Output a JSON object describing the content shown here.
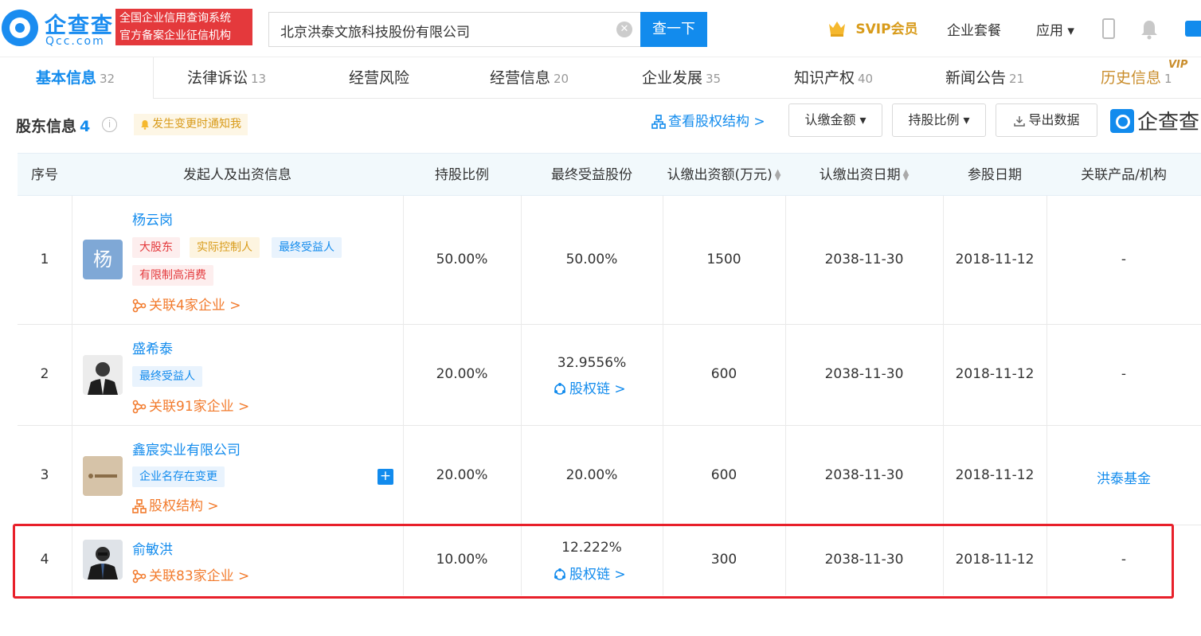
{
  "brand": {
    "logo_cn": "企查查",
    "logo_en": "Qcc.com",
    "slogan_line1": "全国企业信用查询系统",
    "slogan_line2": "官方备案企业征信机构"
  },
  "search": {
    "query": "北京洪泰文旅科技股份有限公司",
    "clear": "✕",
    "button": "查一下"
  },
  "topnav": {
    "svip": "SVIP会员",
    "package": "企业套餐",
    "apps": "应用 ▾"
  },
  "tabs": [
    {
      "label": "基本信息",
      "count": "32"
    },
    {
      "label": "法律诉讼",
      "count": "13"
    },
    {
      "label": "经营风险",
      "count": ""
    },
    {
      "label": "经营信息",
      "count": "20"
    },
    {
      "label": "企业发展",
      "count": "35"
    },
    {
      "label": "知识产权",
      "count": "40"
    },
    {
      "label": "新闻公告",
      "count": "21"
    },
    {
      "label": "历史信息",
      "count": "1"
    }
  ],
  "vip_mark": "VIP",
  "section": {
    "title": "股东信息",
    "count": "4",
    "info": "i",
    "notify": "发生变更时通知我",
    "equity_link": "查看股权结构 >",
    "btn_amount": "认缴金额 ▾",
    "btn_ratio": "持股比例 ▾",
    "btn_export": "导出数据",
    "watermark": "企查查"
  },
  "colors": {
    "primary": "#128bed",
    "orange": "#f27b2d",
    "highlight": "#e8202a"
  },
  "table": {
    "headers": [
      "序号",
      "发起人及出资信息",
      "持股比例",
      "最终受益股份",
      "认缴出资额(万元)",
      "认缴出资日期",
      "参股日期",
      "关联产品/机构"
    ],
    "rows": [
      {
        "no": "1",
        "avatar_text": "杨",
        "name": "杨云岗",
        "tags": [
          "大股东",
          "实际控制人",
          "最终受益人",
          "有限制高消费"
        ],
        "link": "关联4家企业 >",
        "ratio": "50.00%",
        "benefit": "50.00%",
        "benefit_link": "",
        "amount": "1500",
        "date": "2038-11-30",
        "join_date": "2018-11-12",
        "related": "-"
      },
      {
        "no": "2",
        "avatar_text": "",
        "name": "盛希泰",
        "tags": [
          "最终受益人"
        ],
        "link": "关联91家企业 >",
        "ratio": "20.00%",
        "benefit": "32.9556%",
        "benefit_link": "股权链 >",
        "amount": "600",
        "date": "2038-11-30",
        "join_date": "2018-11-12",
        "related": "-"
      },
      {
        "no": "3",
        "avatar_text": "",
        "name": "鑫宸实业有限公司",
        "tags": [
          "企业名存在变更"
        ],
        "link": "股权结构 >",
        "plus": "+",
        "ratio": "20.00%",
        "benefit": "20.00%",
        "benefit_link": "",
        "amount": "600",
        "date": "2038-11-30",
        "join_date": "2018-11-12",
        "related": "洪泰基金"
      },
      {
        "no": "4",
        "avatar_text": "",
        "name": "俞敏洪",
        "tags": [],
        "link": "关联83家企业 >",
        "ratio": "10.00%",
        "benefit": "12.222%",
        "benefit_link": "股权链 >",
        "amount": "300",
        "date": "2038-11-30",
        "join_date": "2018-11-12",
        "related": "-"
      }
    ]
  }
}
